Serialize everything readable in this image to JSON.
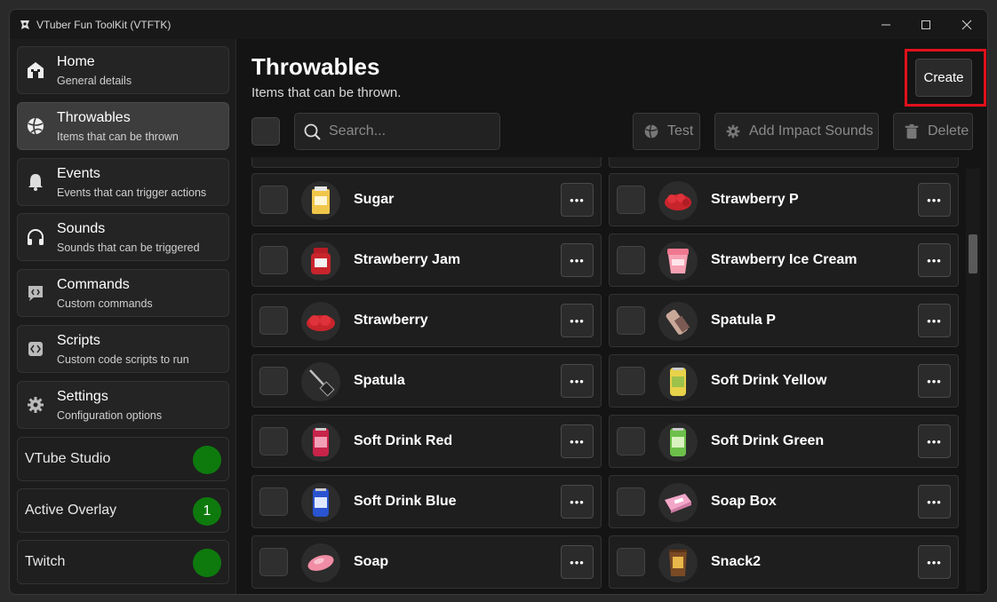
{
  "window": {
    "title": "VTuber Fun ToolKit (VTFTK)",
    "controls": {
      "minimize_icon": "minimize-icon",
      "maximize_icon": "maximize-icon",
      "close_icon": "close-icon"
    }
  },
  "sidebar": {
    "items": [
      {
        "label": "Home",
        "desc": "General details",
        "icon": "home-icon"
      },
      {
        "label": "Throwables",
        "desc": "Items that can be thrown",
        "icon": "ball-icon",
        "active": true
      },
      {
        "label": "Events",
        "desc": "Events that can trigger actions",
        "icon": "bell-icon"
      },
      {
        "label": "Sounds",
        "desc": "Sounds that can be triggered",
        "icon": "headphones-icon"
      },
      {
        "label": "Commands",
        "desc": "Custom commands",
        "icon": "code-chat-icon"
      },
      {
        "label": "Scripts",
        "desc": "Custom code scripts to run",
        "icon": "code-file-icon"
      },
      {
        "label": "Settings",
        "desc": "Configuration options",
        "icon": "gear-icon"
      }
    ],
    "status": [
      {
        "label": "VTube Studio",
        "value": "",
        "color": "#0e7a0e"
      },
      {
        "label": "Active Overlay",
        "value": "1",
        "color": "#0e7a0e"
      },
      {
        "label": "Twitch",
        "value": "",
        "color": "#0e7a0e"
      }
    ]
  },
  "main": {
    "title": "Throwables",
    "subtitle": "Items that can be thrown.",
    "create_label": "Create",
    "search_placeholder": "Search...",
    "toolbar": {
      "test_label": "Test",
      "sounds_label": "Add Impact Sounds",
      "delete_label": "Delete"
    },
    "items": [
      {
        "name": "Sugar",
        "icon": "sugar-icon"
      },
      {
        "name": "Strawberry P",
        "icon": "strawberry-pile-icon"
      },
      {
        "name": "Strawberry Jam",
        "icon": "jam-jar-icon"
      },
      {
        "name": "Strawberry Ice Cream",
        "icon": "ice-cream-icon"
      },
      {
        "name": "Strawberry",
        "icon": "strawberry-icon"
      },
      {
        "name": "Spatula P",
        "icon": "spatula-pile-icon"
      },
      {
        "name": "Spatula",
        "icon": "spatula-icon"
      },
      {
        "name": "Soft Drink Yellow",
        "icon": "can-yellow-icon"
      },
      {
        "name": "Soft Drink Red",
        "icon": "can-red-icon"
      },
      {
        "name": "Soft Drink Green",
        "icon": "can-green-icon"
      },
      {
        "name": "Soft Drink Blue",
        "icon": "can-blue-icon"
      },
      {
        "name": "Soap Box",
        "icon": "soap-box-icon"
      },
      {
        "name": "Soap",
        "icon": "soap-icon"
      },
      {
        "name": "Snack2",
        "icon": "snack-bag-icon"
      }
    ]
  },
  "colors": {
    "accent_green": "#0e7a0e",
    "highlight_red": "#e0101a"
  }
}
